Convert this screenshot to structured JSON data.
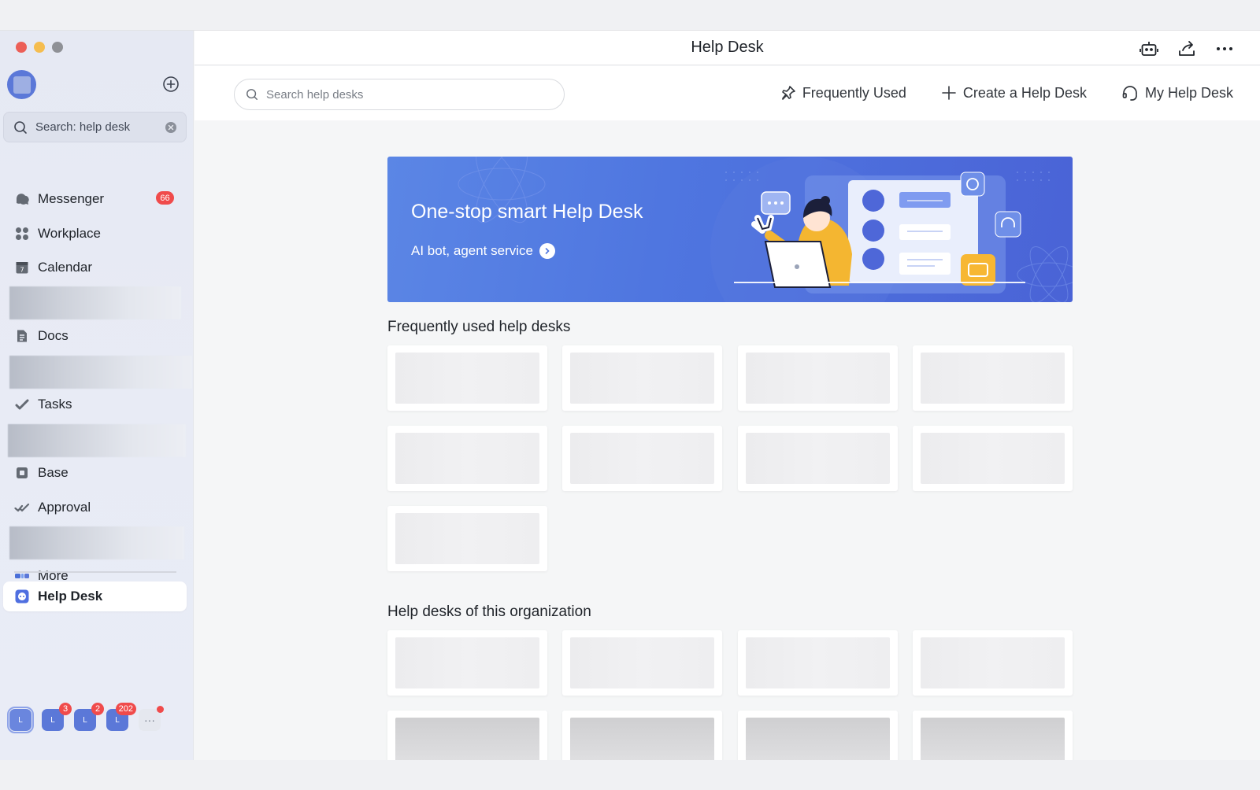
{
  "window": {
    "title": "Help Desk"
  },
  "sidebar": {
    "search_text": "Search: help desk",
    "items": [
      {
        "label": "Messenger",
        "icon": "messenger-icon",
        "badge": "66"
      },
      {
        "label": "Workplace",
        "icon": "workplace-icon"
      },
      {
        "label": "Calendar",
        "icon": "calendar-icon"
      },
      {
        "label": "Docs",
        "icon": "docs-icon"
      },
      {
        "label": "Tasks",
        "icon": "tasks-icon"
      },
      {
        "label": "Base",
        "icon": "base-icon"
      },
      {
        "label": "Approval",
        "icon": "approval-icon"
      },
      {
        "label": "More",
        "icon": "more-apps-icon"
      },
      {
        "label": "Help Desk",
        "icon": "help-desk-icon"
      }
    ],
    "tenants": [
      {
        "label": "L",
        "badge": ""
      },
      {
        "label": "L",
        "badge": "3"
      },
      {
        "label": "L",
        "badge": "2"
      },
      {
        "label": "L",
        "badge": "202"
      },
      {
        "label": "···",
        "badge": ""
      }
    ]
  },
  "toolbar": {
    "search_placeholder": "Search help desks",
    "frequently_used": "Frequently Used",
    "create": "Create a Help Desk",
    "my_help_desk": "My Help Desk"
  },
  "banner": {
    "title": "One-stop smart Help Desk",
    "subtitle": "AI bot, agent service"
  },
  "sections": {
    "frequent": "Frequently used help desks",
    "organization": "Help desks of this organization"
  },
  "colors": {
    "accent": "#4f76e0",
    "badge": "#f04b4b",
    "banner_robot": "#f7b733"
  }
}
